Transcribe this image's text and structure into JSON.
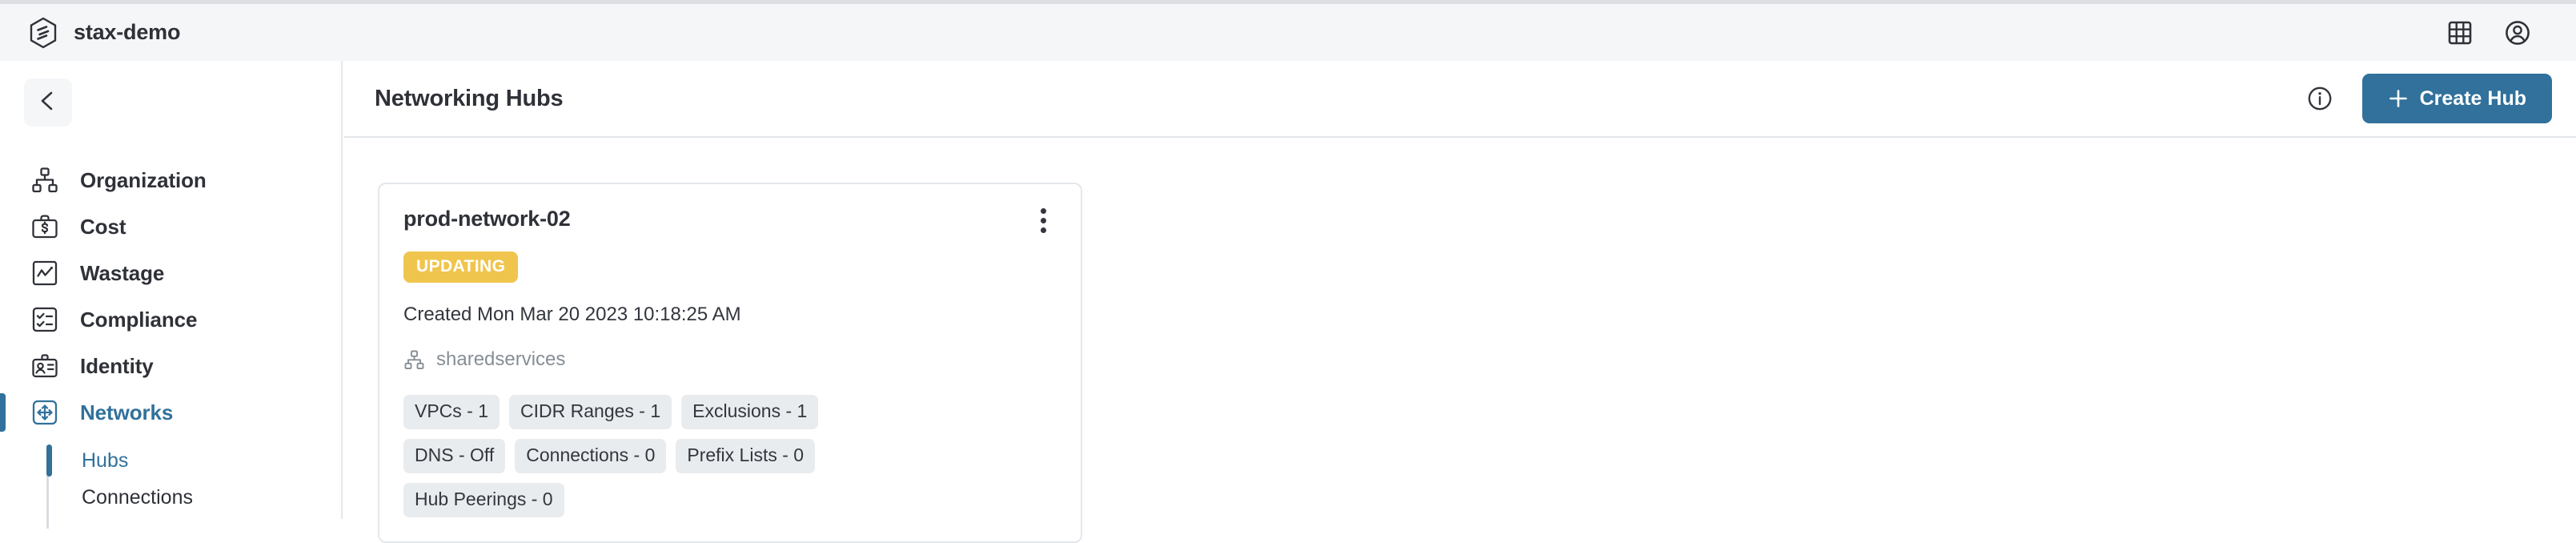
{
  "topbar": {
    "logo_icon": "stax-hexagon-logo",
    "brand": "stax-demo",
    "apps_icon": "grid-apps-icon",
    "account_icon": "user-circle-icon"
  },
  "sidebar": {
    "back_icon": "chevron-left-icon",
    "items": [
      {
        "label": "Organization",
        "icon": "org-chart-icon",
        "active": false
      },
      {
        "label": "Cost",
        "icon": "briefcase-dollar-icon",
        "active": false
      },
      {
        "label": "Wastage",
        "icon": "chart-line-square-icon",
        "active": false
      },
      {
        "label": "Compliance",
        "icon": "checklist-square-icon",
        "active": false
      },
      {
        "label": "Identity",
        "icon": "id-card-icon",
        "active": false
      },
      {
        "label": "Networks",
        "icon": "move-arrows-square-icon",
        "active": true
      }
    ],
    "subitems": [
      {
        "label": "Hubs",
        "active": true
      },
      {
        "label": "Connections",
        "active": false
      }
    ]
  },
  "header": {
    "title": "Networking Hubs",
    "info_icon": "info-circle-icon",
    "create_button": {
      "label": "Create Hub",
      "icon": "plus-icon"
    }
  },
  "colors": {
    "accent": "#31719b",
    "status_updating": "#f0c54e",
    "chip_bg": "#e9ecef",
    "topbar_bg": "#f5f6f8",
    "border": "#e4e7eb"
  },
  "hub_card": {
    "title": "prod-network-02",
    "status": "UPDATING",
    "created": "Created Mon Mar 20 2023 10:18:25 AM",
    "organization": "sharedservices",
    "org_icon": "org-chart-icon",
    "menu_icon": "kebab-menu-icon",
    "chips": [
      "VPCs - 1",
      "CIDR Ranges - 1",
      "Exclusions - 1",
      "DNS - Off",
      "Connections - 0",
      "Prefix Lists - 0",
      "Hub Peerings - 0"
    ]
  }
}
